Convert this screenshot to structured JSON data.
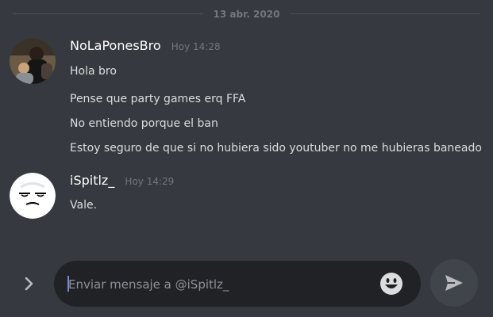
{
  "date_divider": {
    "label": "13 abr. 2020"
  },
  "messages": [
    {
      "author": "NoLaPonesBro",
      "timestamp": "Hoy 14:28",
      "avatar_icon": "user-photo-avatar",
      "lines": [
        "Hola bro",
        "Pense que party games erq FFA",
        "No entiendo porque el ban",
        "Estoy seguro de que si no hubiera sido youtuber no me hubieras baneado"
      ]
    },
    {
      "author": "iSpitlz_",
      "timestamp": "Hoy 14:29",
      "avatar_icon": "sleepy-face-avatar",
      "lines": [
        "Vale."
      ]
    }
  ],
  "composer": {
    "placeholder": "Enviar mensaje a @iSpitlz_",
    "value": "",
    "expand_icon": "chevron-right-icon",
    "emoji_icon": "emoji-smile-icon",
    "send_icon": "send-arrow-icon"
  },
  "colors": {
    "background": "#36393f",
    "input_background": "#202225",
    "text": "#dcddde",
    "username": "#ffffff",
    "muted": "#72767d",
    "accent": "#7289da"
  }
}
